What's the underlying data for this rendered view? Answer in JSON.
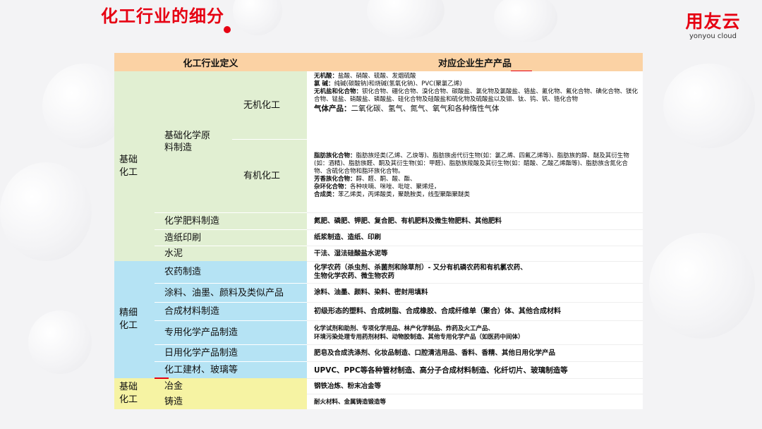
{
  "title": "化工行业的细分",
  "logo": {
    "cn": "用友云",
    "en": "yonyou cloud"
  },
  "table": {
    "headers": {
      "left": "化工行业定义",
      "right": "对应企业生产产品"
    },
    "basic": {
      "category": "基础\n化工",
      "raw_material": "基础化学原\n料制造",
      "inorganic": {
        "label": "无机化工",
        "lines": [
          {
            "head": "无机酸：",
            "text": "盐酸、硝酸、硫酸、发烟硫酸"
          },
          {
            "head": "氯  碱：",
            "text": "纯碱(碳酸钠)和烧碱(氢氧化钠)、PVC(聚氯乙烯)"
          },
          {
            "head": "无机盐和化合物：",
            "text": "钡化合物、硼化合物、溴化合物、碳酸盐、氯化物及氯酸盐、铬盐、氰化物、氟化合物、碘化合物、镁化合物、锰盐、硝酸盐、磷酸盐、硅化合物及硅酸盐和硫化物及硫酸盐以及钼、钛、钨、钒、锆化合物"
          },
          {
            "head": "气体产品：",
            "text": "二氧化碳、氢气、氮气、氧气和各种惰性气体"
          }
        ]
      },
      "organic": {
        "label": "有机化工",
        "lines": [
          {
            "head": "脂肪族化合物：",
            "text": "脂肪族烃类(乙烯、乙炔等)、脂肪族卤代衍生物(如：氯乙烯、四氟乙烯等)、脂肪族的醇、醚及其衍生物(如：酒精)、脂肪族醛、酮及其衍生物(如：甲醛)、脂肪族羧酸及其衍生物(如：醋酸、乙酸乙烯酯等)、脂肪族含氮化合物、含硫化合物和脂环族化合物。"
          },
          {
            "head": "芳香族化合物：",
            "text": "醇、醛、酮、酸、酯、"
          },
          {
            "head": "杂环化合物：",
            "text": "各种呋喃、咪唑、吡啶、聚烯烃，"
          },
          {
            "head": "合成类：",
            "text": "苯乙烯类，丙烯酸类，聚酰胺类，线型聚酯聚醚类"
          }
        ]
      },
      "rows": [
        {
          "label": "化学肥料制造",
          "products": "氮肥、磷肥、钾肥、复合肥、有机肥料及微生物肥料、其他肥料"
        },
        {
          "label": "造纸印刷",
          "products": "纸浆制造、造纸、印刷"
        },
        {
          "label": "水泥",
          "products": "干法、湿法硅酸盐水泥等"
        }
      ]
    },
    "fine": {
      "category": "精细\n化工",
      "rows": [
        {
          "label": "农药制造",
          "products": "化学农药（杀虫剂、杀菌剂和除草剂）- 又分有机磷农药和有机氯农药、\n生物化学农药、微生物农药"
        },
        {
          "label": "涂料、油墨、颜料及类似产品",
          "products": "涂料、油墨、颜料、染料、密封用填料"
        },
        {
          "label": "合成材料制造",
          "products": "初级形态的塑料、合成树脂、合成橡胶、合成纤维单（聚合）体、其他合成材料"
        },
        {
          "label": "专用化学产品制造",
          "products": "化学试剂和助剂、专项化学用品、林产化学制品、炸药及火工产品、\n环境污染处理专用药剂材料、动物胶制造、其他专用化学产品（如医药中间体）"
        },
        {
          "label": "日用化学产品制造",
          "products": "肥皂及合成洗涤剂、化妆品制造、口腔清洁用品、香料、香精、其他日用化学产品"
        },
        {
          "label": "化工建材、玻璃等",
          "products": "UPVC、PPC等各种管材制造、高分子合成材料制造、化纤切片、玻璃制造等"
        }
      ]
    },
    "basic2": {
      "category": "基础\n化工",
      "rows": [
        {
          "label": "冶金",
          "products": "钢铁冶炼、粉末冶金等"
        },
        {
          "label": "铸造",
          "products": "耐火材料、金属铸造锻造等"
        }
      ]
    }
  },
  "colors": {
    "accent": "#e60012",
    "header": "#fbd2a4",
    "green": "#e1efd2",
    "blue": "#b5e3f4",
    "yellow": "#f6f3a3"
  }
}
